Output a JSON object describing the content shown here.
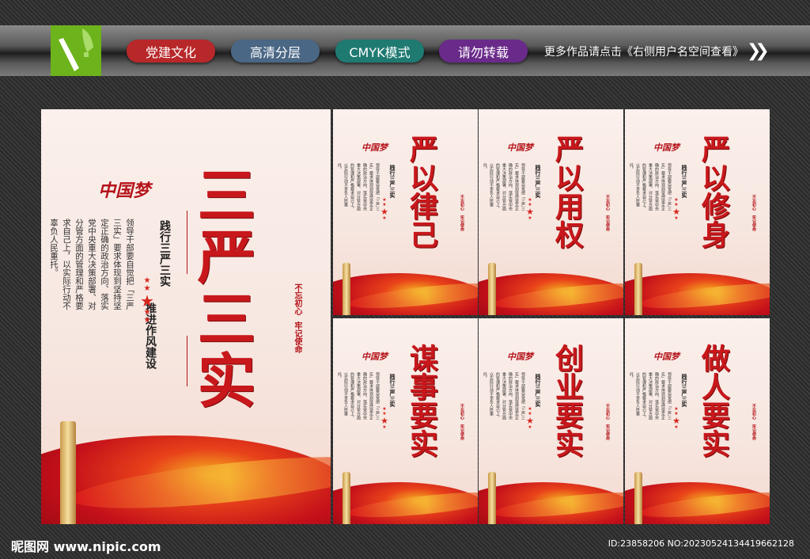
{
  "header": {
    "tags": [
      {
        "label": "党建文化",
        "color": "#b8282a"
      },
      {
        "label": "高清分层",
        "color": "#4a6785"
      },
      {
        "label": "CMYK模式",
        "color": "#1f7a72"
      },
      {
        "label": "请勿转载",
        "color": "#6a2a8a"
      }
    ],
    "notice": "更多作品请点击《右侧用户名空间查看》",
    "arrow_icon": "double-chevron-right-icon"
  },
  "main_poster": {
    "title": "三严三实",
    "logo_text": "中国梦",
    "slogan_1": "践行三严三实",
    "slogan_2": "推进作风建设",
    "body": "领导干部要自觉把「三严三实」要求体现到坚持坚定正确的政治方向、落实党中央重大决策部署、对分管方面的管理和严格要求自己上，以实际行动不辜负人民重托。",
    "motto_1": "不忘初心",
    "motto_2": "牢记使命"
  },
  "posters": [
    {
      "title": "严以律己"
    },
    {
      "title": "严以用权"
    },
    {
      "title": "严以修身"
    },
    {
      "title": "谋事要实"
    },
    {
      "title": "创业要实"
    },
    {
      "title": "做人要实"
    }
  ],
  "footer": {
    "site": "昵图网 www.nipic.com",
    "id": "ID:23858206 NO:20230524134419662128"
  }
}
